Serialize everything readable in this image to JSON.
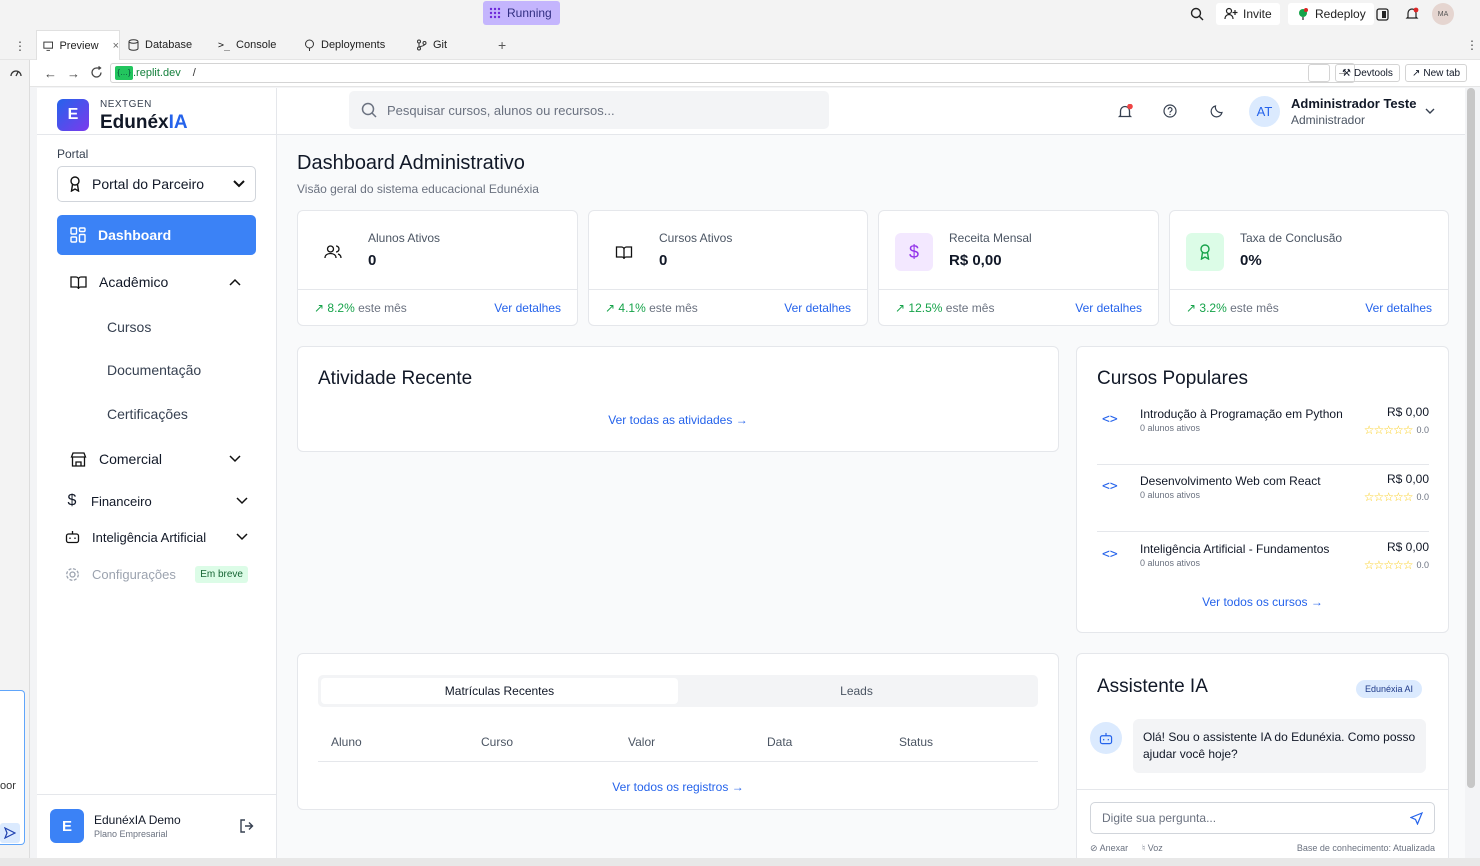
{
  "replit": {
    "running": "Running",
    "invite": "Invite",
    "redeploy": "Redeploy",
    "avatar": "MA",
    "tabs": [
      {
        "label": "Preview"
      },
      {
        "label": "Database"
      },
      {
        "label": "Console"
      },
      {
        "label": "Deployments"
      },
      {
        "label": "Git"
      }
    ],
    "url_host": ".replit.dev",
    "url_path": "/",
    "devtools": "Devtools",
    "newtab": "New tab",
    "left_text": "oor"
  },
  "brand": {
    "top": "NEXTGEN",
    "name_a": "Edunéx",
    "name_b": "IA",
    "logo_letter": "E"
  },
  "sidebar": {
    "portal_label": "Portal",
    "portal_value": "Portal do Parceiro",
    "dashboard": "Dashboard",
    "academico": "Acadêmico",
    "sub": [
      "Cursos",
      "Documentação",
      "Certificações"
    ],
    "comercial": "Comercial",
    "financeiro": "Financeiro",
    "ia": "Inteligência Artificial",
    "config": "Configurações",
    "soon": "Em breve",
    "user_letter": "E",
    "user_name": "EdunéxIA Demo",
    "user_plan": "Plano Empresarial"
  },
  "header": {
    "search_placeholder": "Pesquisar cursos, alunos ou recursos...",
    "avatar": "AT",
    "user": "Administrador Teste",
    "role": "Administrador"
  },
  "page": {
    "title": "Dashboard Administrativo",
    "subtitle": "Visão geral do sistema educacional Edunéxia"
  },
  "stats": [
    {
      "label": "Alunos Ativos",
      "value": "0",
      "trend": "8.2%",
      "trend_suffix": "este mês",
      "link": "Ver detalhes"
    },
    {
      "label": "Cursos Ativos",
      "value": "0",
      "trend": "4.1%",
      "trend_suffix": "este mês",
      "link": "Ver detalhes"
    },
    {
      "label": "Receita Mensal",
      "value": "R$ 0,00",
      "trend": "12.5%",
      "trend_suffix": "este mês",
      "link": "Ver detalhes"
    },
    {
      "label": "Taxa de Conclusão",
      "value": "0%",
      "trend": "3.2%",
      "trend_suffix": "este mês",
      "link": "Ver detalhes"
    }
  ],
  "activity": {
    "title": "Atividade Recente",
    "link": "Ver todas as atividades"
  },
  "popular": {
    "title": "Cursos Populares",
    "link": "Ver todos os cursos",
    "items": [
      {
        "name": "Introdução à Programação em Python",
        "students": "0 alunos ativos",
        "price": "R$ 0,00",
        "rating": "0.0"
      },
      {
        "name": "Desenvolvimento Web com React",
        "students": "0 alunos ativos",
        "price": "R$ 0,00",
        "rating": "0.0"
      },
      {
        "name": "Inteligência Artificial - Fundamentos",
        "students": "0 alunos ativos",
        "price": "R$ 0,00",
        "rating": "0.0"
      }
    ]
  },
  "enroll": {
    "tab_active": "Matrículas Recentes",
    "tab_other": "Leads",
    "columns": [
      "Aluno",
      "Curso",
      "Valor",
      "Data",
      "Status"
    ],
    "link": "Ver todos os registros"
  },
  "assistant": {
    "title": "Assistente IA",
    "badge": "Edunéxia AI",
    "message": "Olá! Sou o assistente IA do Edunéxia. Como posso ajudar você hoje?",
    "placeholder": "Digite sua pergunta...",
    "attach": "Anexar",
    "voice": "Voz",
    "kb": "Base de conhecimento: Atualizada"
  },
  "colors": {
    "primary": "#2563eb",
    "sidebar_active": "#3b82f6",
    "green": "#16a34a",
    "purple": "#9333ea"
  }
}
